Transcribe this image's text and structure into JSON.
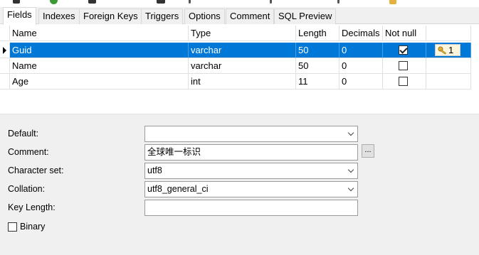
{
  "tabs": [
    {
      "label": "Fields",
      "active": true
    },
    {
      "label": "Indexes"
    },
    {
      "label": "Foreign Keys"
    },
    {
      "label": "Triggers"
    },
    {
      "label": "Options"
    },
    {
      "label": "Comment"
    },
    {
      "label": "SQL Preview"
    }
  ],
  "grid": {
    "columns": [
      "Name",
      "Type",
      "Length",
      "Decimals",
      "Not null",
      ""
    ],
    "rows": [
      {
        "name": "Guid",
        "type": "varchar",
        "length": "50",
        "decimals": "0",
        "not_null": true,
        "key": "1",
        "selected": true
      },
      {
        "name": "Name",
        "type": "varchar",
        "length": "50",
        "decimals": "0",
        "not_null": false,
        "key": ""
      },
      {
        "name": "Age",
        "type": "int",
        "length": "11",
        "decimals": "0",
        "not_null": false,
        "key": ""
      }
    ]
  },
  "properties": {
    "default_label": "Default:",
    "default_value": "",
    "comment_label": "Comment:",
    "comment_value": "全球唯一标识",
    "ellipsis_label": "...",
    "charset_label": "Character set:",
    "charset_value": "utf8",
    "collation_label": "Collation:",
    "collation_value": "utf8_general_ci",
    "keylength_label": "Key Length:",
    "keylength_value": "",
    "binary_label": "Binary",
    "binary_checked": false
  },
  "colors": {
    "selection": "#0078d7",
    "key_badge": "#fdf6dc",
    "key_icon": "#e3b13c"
  }
}
